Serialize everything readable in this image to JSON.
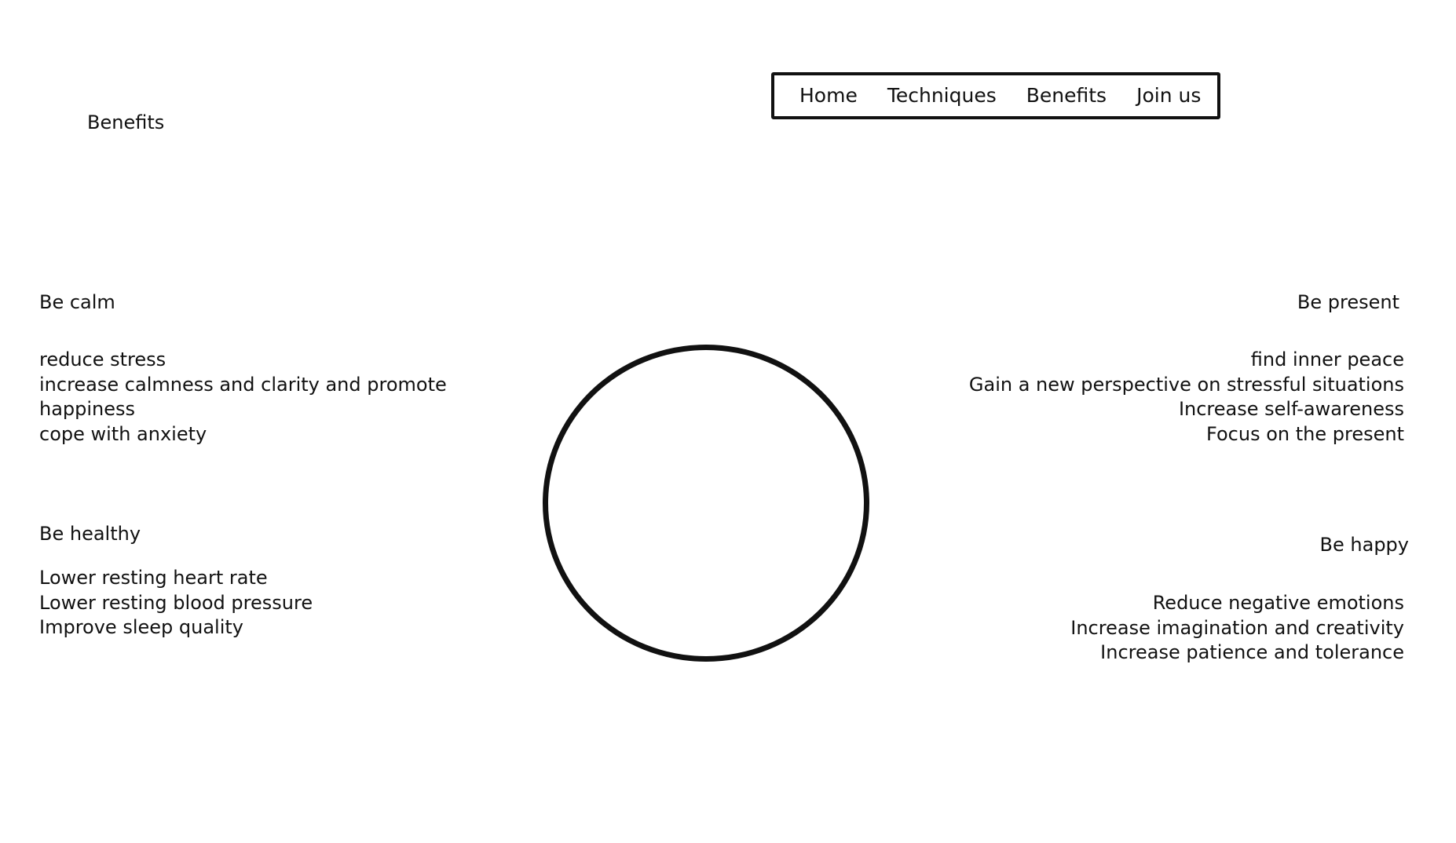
{
  "page": {
    "heading": "Benefits"
  },
  "nav": {
    "items": [
      {
        "label": "Home"
      },
      {
        "label": "Techniques"
      },
      {
        "label": "Benefits"
      },
      {
        "label": "Join us"
      }
    ]
  },
  "sections": {
    "calm": {
      "title": "Be calm",
      "items": [
        "reduce stress",
        "increase calmness and clarity and promote",
        "happiness",
        "cope with anxiety"
      ]
    },
    "healthy": {
      "title": "Be healthy",
      "items": [
        "Lower resting heart rate",
        "Lower resting blood pressure",
        "Improve sleep quality"
      ]
    },
    "present": {
      "title": "Be present",
      "items": [
        "find inner peace",
        "Gain a new perspective on stressful situations",
        "Increase self-awareness",
        "Focus on the present"
      ]
    },
    "happy": {
      "title": "Be happy",
      "items": [
        "Reduce negative emotions",
        "Increase imagination and creativity",
        "Increase patience and tolerance"
      ]
    }
  }
}
